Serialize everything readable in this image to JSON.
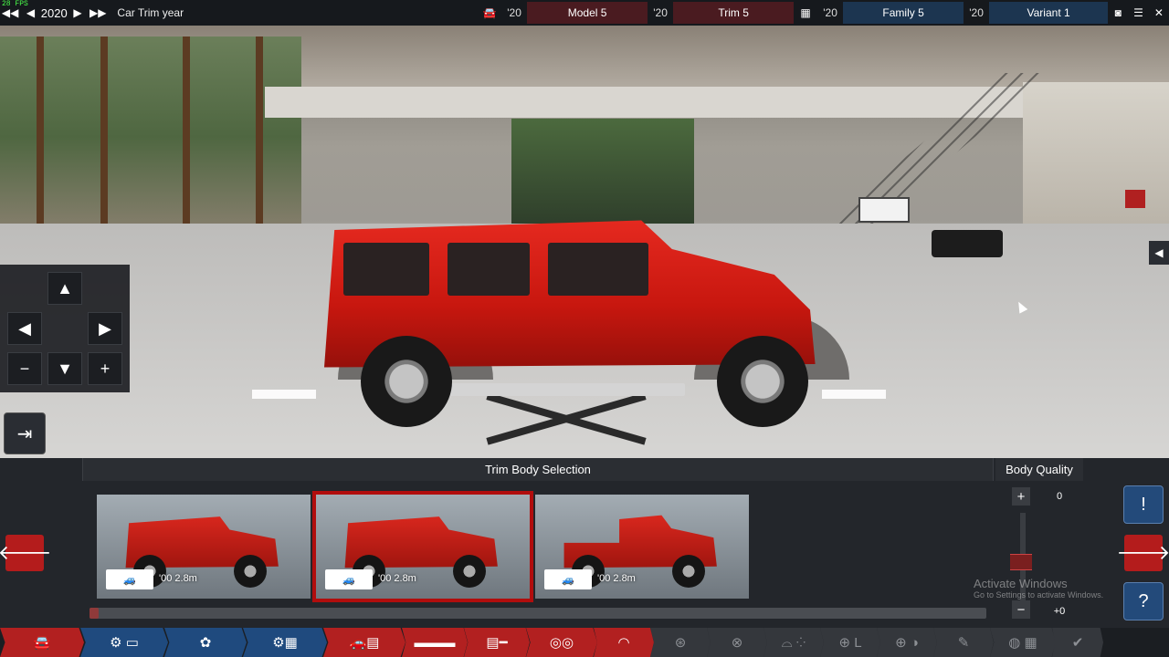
{
  "fps": "28 FPS",
  "topbar": {
    "prev_prev_icon": "double-left-arrow-icon",
    "prev_icon": "left-arrow-icon",
    "year": "2020",
    "next_icon": "right-arrow-icon",
    "next_next_icon": "double-right-arrow-icon",
    "label": "Car Trim year",
    "model": {
      "icon": "car-model-icon",
      "year": "'20",
      "name": "Model 5"
    },
    "trim": {
      "year": "'20",
      "name": "Trim 5"
    },
    "family": {
      "icon": "engine-family-icon",
      "year": "'20",
      "name": "Family 5"
    },
    "variant": {
      "year": "'20",
      "name": "Variant 1"
    },
    "screenshot_icon": "camera-icon",
    "menu_icon": "menu-icon",
    "close_icon": "close-icon"
  },
  "navpad": {
    "up": "▲",
    "left": "◀",
    "right": "▶",
    "minus": "−",
    "down": "▼",
    "plus": "+"
  },
  "exit_icon": "exit-view-icon",
  "side_collapse": "◀",
  "panel": {
    "title": "Trim Body Selection",
    "back_arrow": "🡐",
    "next_arrow": "🡒",
    "bodies": [
      {
        "label": "'00 2.8m",
        "type": "suv"
      },
      {
        "label": "'00 2.8m",
        "type": "suv",
        "selected": true
      },
      {
        "label": "'00 2.8m",
        "type": "pickup"
      }
    ],
    "scroll_fraction": 0.01
  },
  "body_quality": {
    "title": "Body Quality",
    "plus": "+",
    "value": "0",
    "minus": "−",
    "delta": "+0",
    "level": 0.5
  },
  "info_icon": "!",
  "help_icon": "?",
  "watermark": {
    "line1": "Activate Windows",
    "line2": "Go to Settings to activate Windows."
  },
  "colors": {
    "accent_red": "#b22020",
    "accent_blue": "#1f4a7e",
    "car_red": "#d8221a"
  },
  "toolbar": {
    "tools": [
      {
        "name": "car-body-tool",
        "glyph": "🚘",
        "color": "red"
      },
      {
        "name": "engine-chassis-tool",
        "glyph": "⚙ ▭",
        "color": "blue"
      },
      {
        "name": "engine-block-tool",
        "glyph": "✿",
        "color": "blue"
      },
      {
        "name": "engine-parts-tool",
        "glyph": "⚙▦",
        "color": "blue"
      },
      {
        "name": "trim-body-tool",
        "glyph": "🚗▤",
        "color": "red"
      },
      {
        "name": "trim-interior-tool",
        "glyph": "▬▬▬",
        "color": "red"
      },
      {
        "name": "trim-fixtures-tool",
        "glyph": "▤━",
        "color": "red"
      },
      {
        "name": "trim-chassis-tool",
        "glyph": "◎◎",
        "color": "red"
      },
      {
        "name": "trim-suspension-tool",
        "glyph": "◠",
        "color": "red"
      },
      {
        "name": "wheels-tool",
        "glyph": "⊛",
        "color": "grey"
      },
      {
        "name": "tires-tool",
        "glyph": "⊗",
        "color": "grey"
      },
      {
        "name": "aero-tool",
        "glyph": "⌓ ⁘",
        "color": "grey"
      },
      {
        "name": "steering-tool",
        "glyph": "⊕ L",
        "color": "grey"
      },
      {
        "name": "drivetrain-tool",
        "glyph": "⊕ ◑",
        "color": "grey"
      },
      {
        "name": "tuning-tool",
        "glyph": "✎",
        "color": "grey"
      },
      {
        "name": "testing-tool",
        "glyph": "◍ ▦",
        "color": "grey"
      },
      {
        "name": "finish-tool",
        "glyph": "✔",
        "color": "grey"
      }
    ]
  }
}
